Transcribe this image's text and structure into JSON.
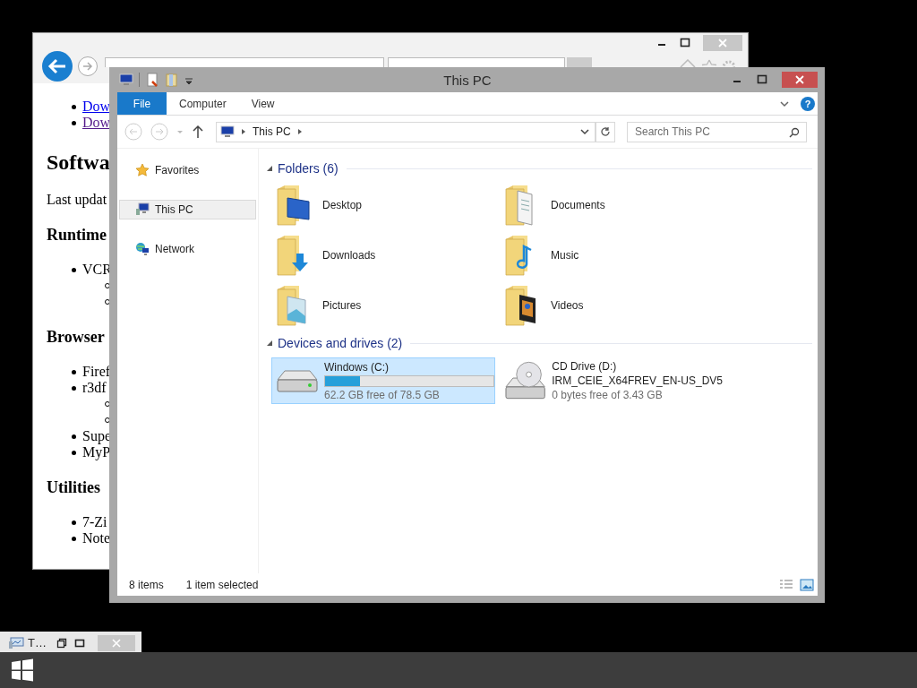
{
  "browser": {
    "content": [
      {
        "kind": "list",
        "items": [
          {
            "kind": "link",
            "text": "Dow",
            "visited": false
          },
          {
            "kind": "link",
            "text": "Dow",
            "visited": true
          }
        ]
      },
      {
        "kind": "h1",
        "text": "Softwa"
      },
      {
        "kind": "p",
        "text": "Last updat"
      },
      {
        "kind": "h2",
        "text": "Runtime"
      },
      {
        "kind": "list",
        "items": [
          {
            "kind": "text",
            "text": "VCR",
            "children": [
              {
                "kind": "bullet"
              },
              {
                "kind": "bullet"
              }
            ]
          }
        ]
      },
      {
        "kind": "h2",
        "text": "Browser"
      },
      {
        "kind": "list",
        "items": [
          {
            "kind": "text",
            "text": "Firef"
          },
          {
            "kind": "text",
            "text": "r3df",
            "children": [
              {
                "kind": "bullet"
              },
              {
                "kind": "bullet"
              }
            ]
          },
          {
            "kind": "text",
            "text": "Supe"
          },
          {
            "kind": "text",
            "text": "MyP"
          }
        ]
      },
      {
        "kind": "h2",
        "text": "Utilities"
      },
      {
        "kind": "list",
        "items": [
          {
            "kind": "text",
            "text": "7-Zi"
          },
          {
            "kind": "text",
            "text": "Note"
          }
        ]
      }
    ]
  },
  "explorer": {
    "title": "This PC",
    "ribbon_tabs": [
      {
        "label": "File",
        "selected": true
      },
      {
        "label": "Computer",
        "selected": false
      },
      {
        "label": "View",
        "selected": false
      }
    ],
    "help": "?",
    "address": {
      "path": "This PC"
    },
    "search": {
      "placeholder": "Search This PC"
    },
    "nav": [
      {
        "label": "Favorites",
        "kind": "favorites",
        "selected": false
      },
      {
        "label": "This PC",
        "kind": "pc",
        "selected": true
      },
      {
        "label": "Network",
        "kind": "network",
        "selected": false
      }
    ],
    "folders": {
      "title": "Folders (6)",
      "expanded": true,
      "items": [
        {
          "label": "Desktop",
          "kind": "desktop"
        },
        {
          "label": "Documents",
          "kind": "documents"
        },
        {
          "label": "Downloads",
          "kind": "downloads"
        },
        {
          "label": "Music",
          "kind": "music"
        },
        {
          "label": "Pictures",
          "kind": "pictures"
        },
        {
          "label": "Videos",
          "kind": "videos"
        }
      ]
    },
    "drives": {
      "title": "Devices and drives (2)",
      "expanded": true,
      "items": [
        {
          "kind": "disk",
          "name": "Windows (C:)",
          "selected": true,
          "level": 0.21,
          "free": "62.2 GB free of 78.5 GB"
        },
        {
          "kind": "cd",
          "name": "CD Drive (D:)",
          "volume": "IRM_CEIE_X64FREV_EN-US_DV5",
          "selected": false,
          "free": "0 bytes free of 3.43 GB"
        }
      ]
    },
    "status": {
      "count": "8 items",
      "selection": "1 item selected"
    }
  },
  "minimized_window": {
    "title": "T…"
  }
}
